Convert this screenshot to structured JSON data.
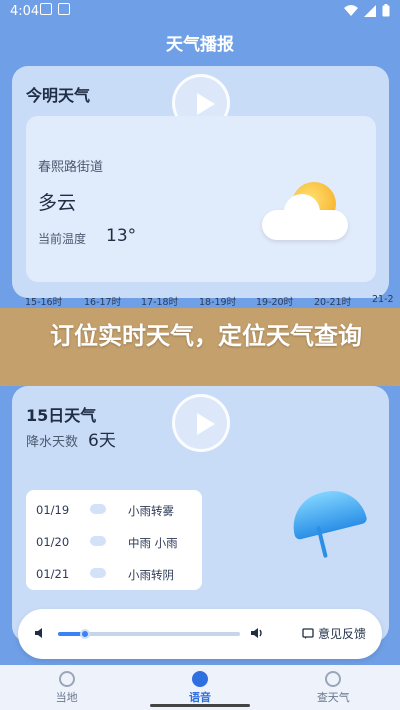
{
  "status": {
    "time": "4:04"
  },
  "app_title": "天气播报",
  "today": {
    "title": "今明天气",
    "street": "春熙路街道",
    "condition": "多云",
    "temp_label": "当前温度",
    "temp_value": "13°",
    "hours": [
      "15-16时",
      "16-17时",
      "17-18时",
      "18-19时",
      "19-20时",
      "20-21时",
      "21-2"
    ]
  },
  "banner": {
    "text": "订位实时天气，定位天气查询"
  },
  "day15": {
    "title": "15日天气",
    "rain_label": "降水天数",
    "rain_value": "6天",
    "forecast": [
      {
        "date": "01/19",
        "weather": "小雨转雾"
      },
      {
        "date": "01/20",
        "weather": "中雨    小雨"
      },
      {
        "date": "01/21",
        "weather": "小雨转阴"
      }
    ]
  },
  "player": {
    "feedback_label": "意见反馈",
    "progress": 0.15
  },
  "tabs": [
    {
      "label": "当地",
      "active": false
    },
    {
      "label": "语音",
      "active": true
    },
    {
      "label": "查天气",
      "active": false
    }
  ],
  "colors": {
    "accent": "#3b82f6",
    "background": "#6f9fe6",
    "banner": "#d7a050"
  }
}
